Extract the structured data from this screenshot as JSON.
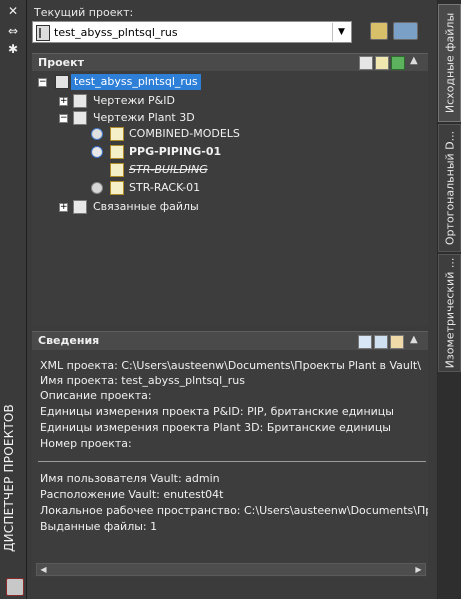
{
  "palette": {
    "title": "ДИСПЕТЧЕР ПРОЕКТОВ",
    "close": "✕",
    "pin": "⇔",
    "settings": "✱"
  },
  "toolbar": {
    "current_project_label": "Текущий проект:",
    "current_project_value": "test_abyss_plntsql_rus"
  },
  "project_panel": {
    "title": "Проект",
    "tree": [
      {
        "label": "test_abyss_plntsql_rus",
        "selected": true
      },
      {
        "label": "Чертежи P&ID"
      },
      {
        "label": "Чертежи Plant 3D"
      },
      {
        "label": "COMBINED-MODELS"
      },
      {
        "label": "PPG-PIPING-01"
      },
      {
        "label": "STR-BUILDING"
      },
      {
        "label": "STR-RACK-01"
      },
      {
        "label": "Связанные файлы"
      }
    ]
  },
  "info_panel": {
    "title": "Сведения",
    "lines": [
      "XML проекта:  C:\\Users\\austeenw\\Documents\\Проекты  Plant  в  Vault\\",
      "Имя  проекта:  test_abyss_plntsql_rus",
      "Описание  проекта:",
      "Единицы  измерения  проекта  P&ID:  PIP,  британские  единицы",
      "Единицы  измерения  проекта  Plant  3D:  Британские  единицы",
      "Номер  проекта:",
      "Имя  пользователя  Vault:  admin",
      "Расположение  Vault:  enutest04t",
      "Локальное  рабочее  пространство:  C:\\Users\\austeenw\\Documents\\Пр",
      "Выданные  файлы:  1"
    ]
  },
  "right_tabs": [
    {
      "label": "Исходные файлы",
      "active": true
    },
    {
      "label": "Ортогональный D..."
    },
    {
      "label": "Изометрический ..."
    }
  ]
}
